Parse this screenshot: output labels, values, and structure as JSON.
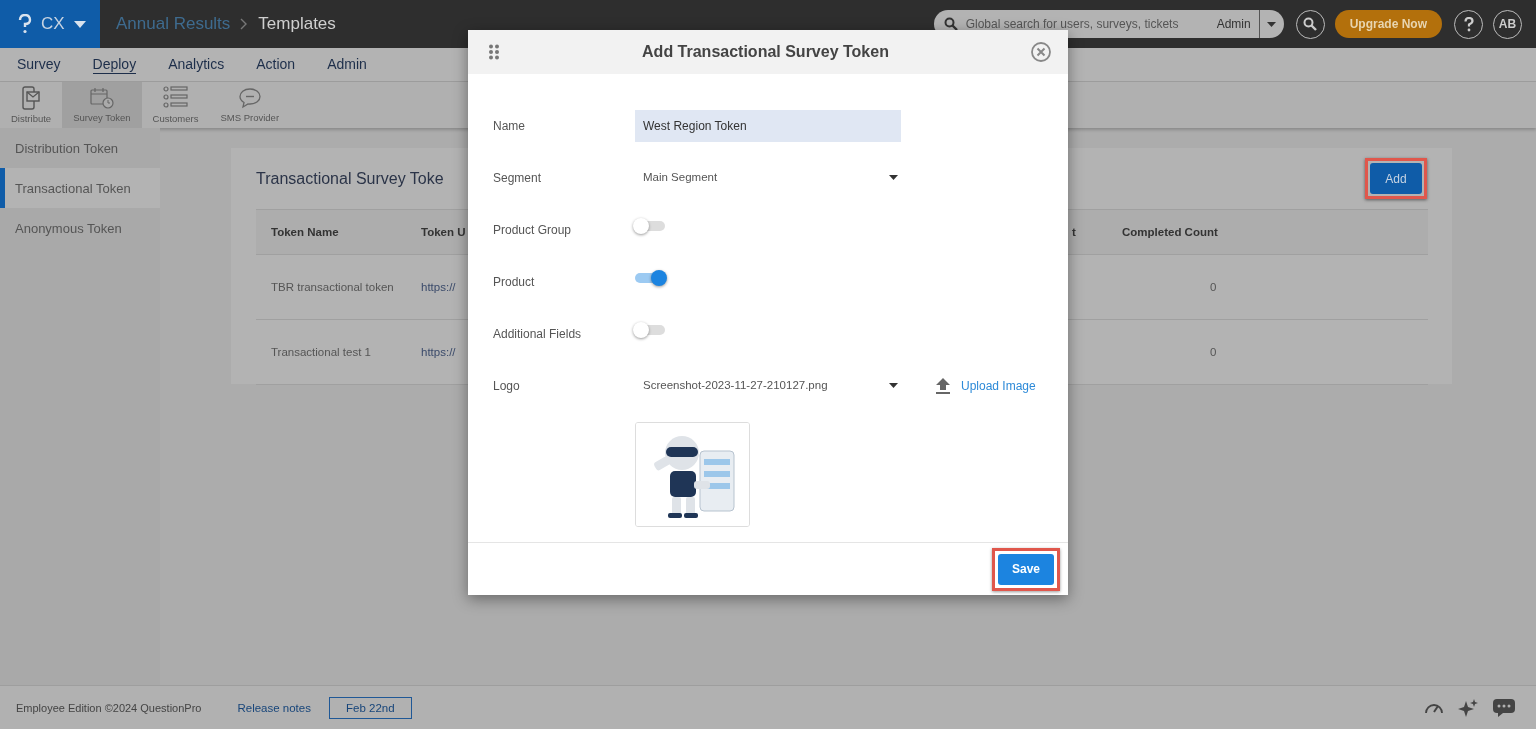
{
  "topbar": {
    "brand": "CX",
    "breadcrumb": [
      "Annual Results",
      "Templates"
    ],
    "search": {
      "placeholder": "Global search for users, surveys, tickets",
      "scope": "Admin"
    },
    "upgrade": "Upgrade Now",
    "avatar": "AB"
  },
  "nav": [
    {
      "label": "Survey",
      "selected": false
    },
    {
      "label": "Deploy",
      "selected": true
    },
    {
      "label": "Analytics",
      "selected": false
    },
    {
      "label": "Action",
      "selected": false
    },
    {
      "label": "Admin",
      "selected": false
    }
  ],
  "subnav": [
    {
      "label": "Distribute",
      "kind": "distribute",
      "selected": false
    },
    {
      "label": "Survey Token",
      "kind": "calendar",
      "selected": true
    },
    {
      "label": "Customers",
      "kind": "customers",
      "selected": false
    },
    {
      "label": "SMS Provider",
      "kind": "sms",
      "selected": false
    }
  ],
  "sidebar": [
    {
      "label": "Distribution Token",
      "selected": false
    },
    {
      "label": "Transactional Token",
      "selected": true
    },
    {
      "label": "Anonymous Token",
      "selected": false
    }
  ],
  "card": {
    "title": "Transactional Survey Toke",
    "add": "Add",
    "columns": [
      "Token Name",
      "Token U",
      "t",
      "Completed Count"
    ],
    "rows": [
      {
        "name": "TBR transactional token",
        "url": "https://",
        "completed": "0"
      },
      {
        "name": "Transactional test 1",
        "url": "https://",
        "completed": "0"
      }
    ]
  },
  "modal": {
    "title": "Add Transactional Survey Token",
    "fields": [
      {
        "kind": "text",
        "label": "Name",
        "value": "West Region Token"
      },
      {
        "kind": "select",
        "label": "Segment",
        "value": "Main Segment"
      },
      {
        "kind": "toggle",
        "label": "Product Group",
        "on": false
      },
      {
        "kind": "toggle",
        "label": "Product",
        "on": true
      },
      {
        "kind": "toggle",
        "label": "Additional Fields",
        "on": false
      },
      {
        "kind": "upload",
        "label": "Logo",
        "value": "Screenshot-2023-11-27-210127.png",
        "action": "Upload Image"
      }
    ],
    "save": "Save"
  },
  "footer": {
    "copyright": "Employee Edition ©2024 QuestionPro",
    "release": "Release notes",
    "date": "Feb 22nd"
  }
}
